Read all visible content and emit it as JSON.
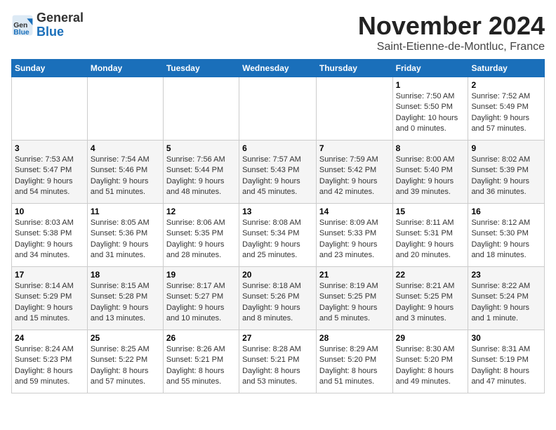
{
  "header": {
    "logo_general": "General",
    "logo_blue": "Blue",
    "month": "November 2024",
    "location": "Saint-Etienne-de-Montluc, France"
  },
  "weekdays": [
    "Sunday",
    "Monday",
    "Tuesday",
    "Wednesday",
    "Thursday",
    "Friday",
    "Saturday"
  ],
  "weeks": [
    [
      {
        "day": "",
        "info": ""
      },
      {
        "day": "",
        "info": ""
      },
      {
        "day": "",
        "info": ""
      },
      {
        "day": "",
        "info": ""
      },
      {
        "day": "",
        "info": ""
      },
      {
        "day": "1",
        "info": "Sunrise: 7:50 AM\nSunset: 5:50 PM\nDaylight: 10 hours and 0 minutes."
      },
      {
        "day": "2",
        "info": "Sunrise: 7:52 AM\nSunset: 5:49 PM\nDaylight: 9 hours and 57 minutes."
      }
    ],
    [
      {
        "day": "3",
        "info": "Sunrise: 7:53 AM\nSunset: 5:47 PM\nDaylight: 9 hours and 54 minutes."
      },
      {
        "day": "4",
        "info": "Sunrise: 7:54 AM\nSunset: 5:46 PM\nDaylight: 9 hours and 51 minutes."
      },
      {
        "day": "5",
        "info": "Sunrise: 7:56 AM\nSunset: 5:44 PM\nDaylight: 9 hours and 48 minutes."
      },
      {
        "day": "6",
        "info": "Sunrise: 7:57 AM\nSunset: 5:43 PM\nDaylight: 9 hours and 45 minutes."
      },
      {
        "day": "7",
        "info": "Sunrise: 7:59 AM\nSunset: 5:42 PM\nDaylight: 9 hours and 42 minutes."
      },
      {
        "day": "8",
        "info": "Sunrise: 8:00 AM\nSunset: 5:40 PM\nDaylight: 9 hours and 39 minutes."
      },
      {
        "day": "9",
        "info": "Sunrise: 8:02 AM\nSunset: 5:39 PM\nDaylight: 9 hours and 36 minutes."
      }
    ],
    [
      {
        "day": "10",
        "info": "Sunrise: 8:03 AM\nSunset: 5:38 PM\nDaylight: 9 hours and 34 minutes."
      },
      {
        "day": "11",
        "info": "Sunrise: 8:05 AM\nSunset: 5:36 PM\nDaylight: 9 hours and 31 minutes."
      },
      {
        "day": "12",
        "info": "Sunrise: 8:06 AM\nSunset: 5:35 PM\nDaylight: 9 hours and 28 minutes."
      },
      {
        "day": "13",
        "info": "Sunrise: 8:08 AM\nSunset: 5:34 PM\nDaylight: 9 hours and 25 minutes."
      },
      {
        "day": "14",
        "info": "Sunrise: 8:09 AM\nSunset: 5:33 PM\nDaylight: 9 hours and 23 minutes."
      },
      {
        "day": "15",
        "info": "Sunrise: 8:11 AM\nSunset: 5:31 PM\nDaylight: 9 hours and 20 minutes."
      },
      {
        "day": "16",
        "info": "Sunrise: 8:12 AM\nSunset: 5:30 PM\nDaylight: 9 hours and 18 minutes."
      }
    ],
    [
      {
        "day": "17",
        "info": "Sunrise: 8:14 AM\nSunset: 5:29 PM\nDaylight: 9 hours and 15 minutes."
      },
      {
        "day": "18",
        "info": "Sunrise: 8:15 AM\nSunset: 5:28 PM\nDaylight: 9 hours and 13 minutes."
      },
      {
        "day": "19",
        "info": "Sunrise: 8:17 AM\nSunset: 5:27 PM\nDaylight: 9 hours and 10 minutes."
      },
      {
        "day": "20",
        "info": "Sunrise: 8:18 AM\nSunset: 5:26 PM\nDaylight: 9 hours and 8 minutes."
      },
      {
        "day": "21",
        "info": "Sunrise: 8:19 AM\nSunset: 5:25 PM\nDaylight: 9 hours and 5 minutes."
      },
      {
        "day": "22",
        "info": "Sunrise: 8:21 AM\nSunset: 5:25 PM\nDaylight: 9 hours and 3 minutes."
      },
      {
        "day": "23",
        "info": "Sunrise: 8:22 AM\nSunset: 5:24 PM\nDaylight: 9 hours and 1 minute."
      }
    ],
    [
      {
        "day": "24",
        "info": "Sunrise: 8:24 AM\nSunset: 5:23 PM\nDaylight: 8 hours and 59 minutes."
      },
      {
        "day": "25",
        "info": "Sunrise: 8:25 AM\nSunset: 5:22 PM\nDaylight: 8 hours and 57 minutes."
      },
      {
        "day": "26",
        "info": "Sunrise: 8:26 AM\nSunset: 5:21 PM\nDaylight: 8 hours and 55 minutes."
      },
      {
        "day": "27",
        "info": "Sunrise: 8:28 AM\nSunset: 5:21 PM\nDaylight: 8 hours and 53 minutes."
      },
      {
        "day": "28",
        "info": "Sunrise: 8:29 AM\nSunset: 5:20 PM\nDaylight: 8 hours and 51 minutes."
      },
      {
        "day": "29",
        "info": "Sunrise: 8:30 AM\nSunset: 5:20 PM\nDaylight: 8 hours and 49 minutes."
      },
      {
        "day": "30",
        "info": "Sunrise: 8:31 AM\nSunset: 5:19 PM\nDaylight: 8 hours and 47 minutes."
      }
    ]
  ]
}
